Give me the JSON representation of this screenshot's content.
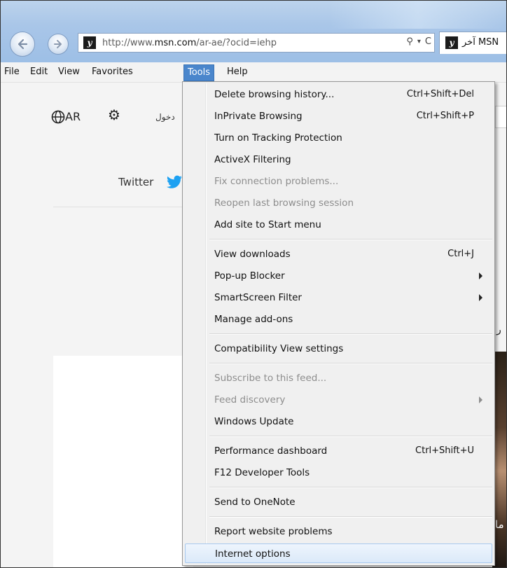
{
  "browser": {
    "url_prefix": "http://www.",
    "url_domain": "msn.com",
    "url_path": "/ar-ae/?ocid=iehp",
    "search_glyph": "⚲",
    "dropdown_glyph": "▾",
    "refresh_glyph": "C",
    "tab_label": "آخر MSN",
    "favicon_letter": "y"
  },
  "menubar": {
    "file": "File",
    "edit": "Edit",
    "view": "View",
    "favorites": "Favorites",
    "tools": "Tools",
    "help": "Help"
  },
  "page": {
    "lang": "AR",
    "signin": "دخول",
    "twitter": "Twitter",
    "right_text": "ر",
    "right_img_text": "ما"
  },
  "tools_menu": {
    "items": [
      {
        "label": "Delete browsing history...",
        "shortcut": "Ctrl+Shift+Del"
      },
      {
        "label": "InPrivate Browsing",
        "shortcut": "Ctrl+Shift+P"
      },
      {
        "label": "Turn on Tracking Protection",
        "shortcut": ""
      },
      {
        "label": "ActiveX Filtering",
        "shortcut": ""
      },
      {
        "label": "Fix connection problems...",
        "shortcut": "",
        "disabled": true
      },
      {
        "label": "Reopen last browsing session",
        "shortcut": "",
        "disabled": true
      },
      {
        "label": "Add site to Start menu",
        "shortcut": ""
      },
      {
        "label": "View downloads",
        "shortcut": "Ctrl+J"
      },
      {
        "label": "Pop-up Blocker",
        "submenu": true
      },
      {
        "label": "SmartScreen Filter",
        "submenu": true
      },
      {
        "label": "Manage add-ons",
        "shortcut": ""
      },
      {
        "label": "Compatibility View settings",
        "shortcut": ""
      },
      {
        "label": "Subscribe to this feed...",
        "shortcut": "",
        "disabled": true
      },
      {
        "label": "Feed discovery",
        "submenu": true,
        "disabled": true
      },
      {
        "label": "Windows Update",
        "shortcut": ""
      },
      {
        "label": "Performance dashboard",
        "shortcut": "Ctrl+Shift+U"
      },
      {
        "label": "F12 Developer Tools",
        "shortcut": ""
      },
      {
        "label": "Send to OneNote",
        "shortcut": ""
      },
      {
        "label": "Report website problems",
        "shortcut": ""
      },
      {
        "label": "Internet options",
        "shortcut": "",
        "highlighted": true
      }
    ]
  },
  "colors": {
    "menu_highlight": "#4a86cc",
    "title_gradient": "#a9c6e8",
    "twitter_blue": "#1da1f2"
  }
}
